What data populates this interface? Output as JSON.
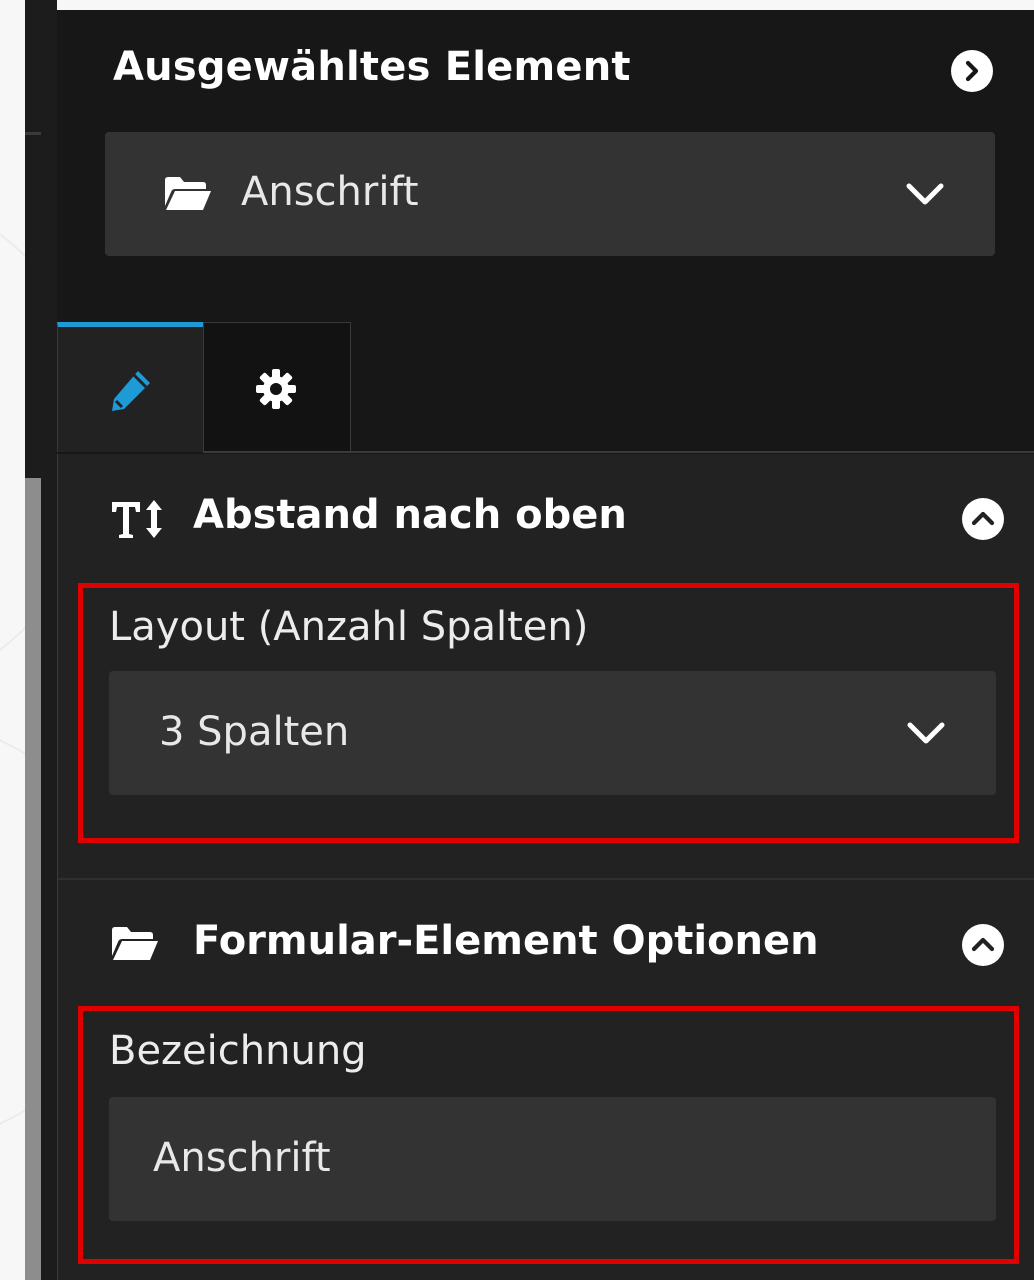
{
  "panel": {
    "title": "Ausgewähltes Element",
    "element_select": {
      "icon": "folder-open-icon",
      "value": "Anschrift"
    }
  },
  "tabs": [
    {
      "icon": "pencil-icon",
      "active": true
    },
    {
      "icon": "gear-icon",
      "active": false
    }
  ],
  "sections": {
    "spacing": {
      "icon": "text-height-icon",
      "title": "Abstand nach oben",
      "field": {
        "label": "Layout (Anzahl Spalten)",
        "value": "3 Spalten"
      }
    },
    "form_options": {
      "icon": "folder-open-icon",
      "title": "Formular-Element Optionen",
      "field": {
        "label": "Bezeichnung",
        "value": "Anschrift"
      }
    }
  },
  "colors": {
    "accent": "#1e9bd7",
    "highlight": "#e00000",
    "panel_bg": "#171717",
    "content_bg": "#222222",
    "field_bg": "#333333"
  }
}
